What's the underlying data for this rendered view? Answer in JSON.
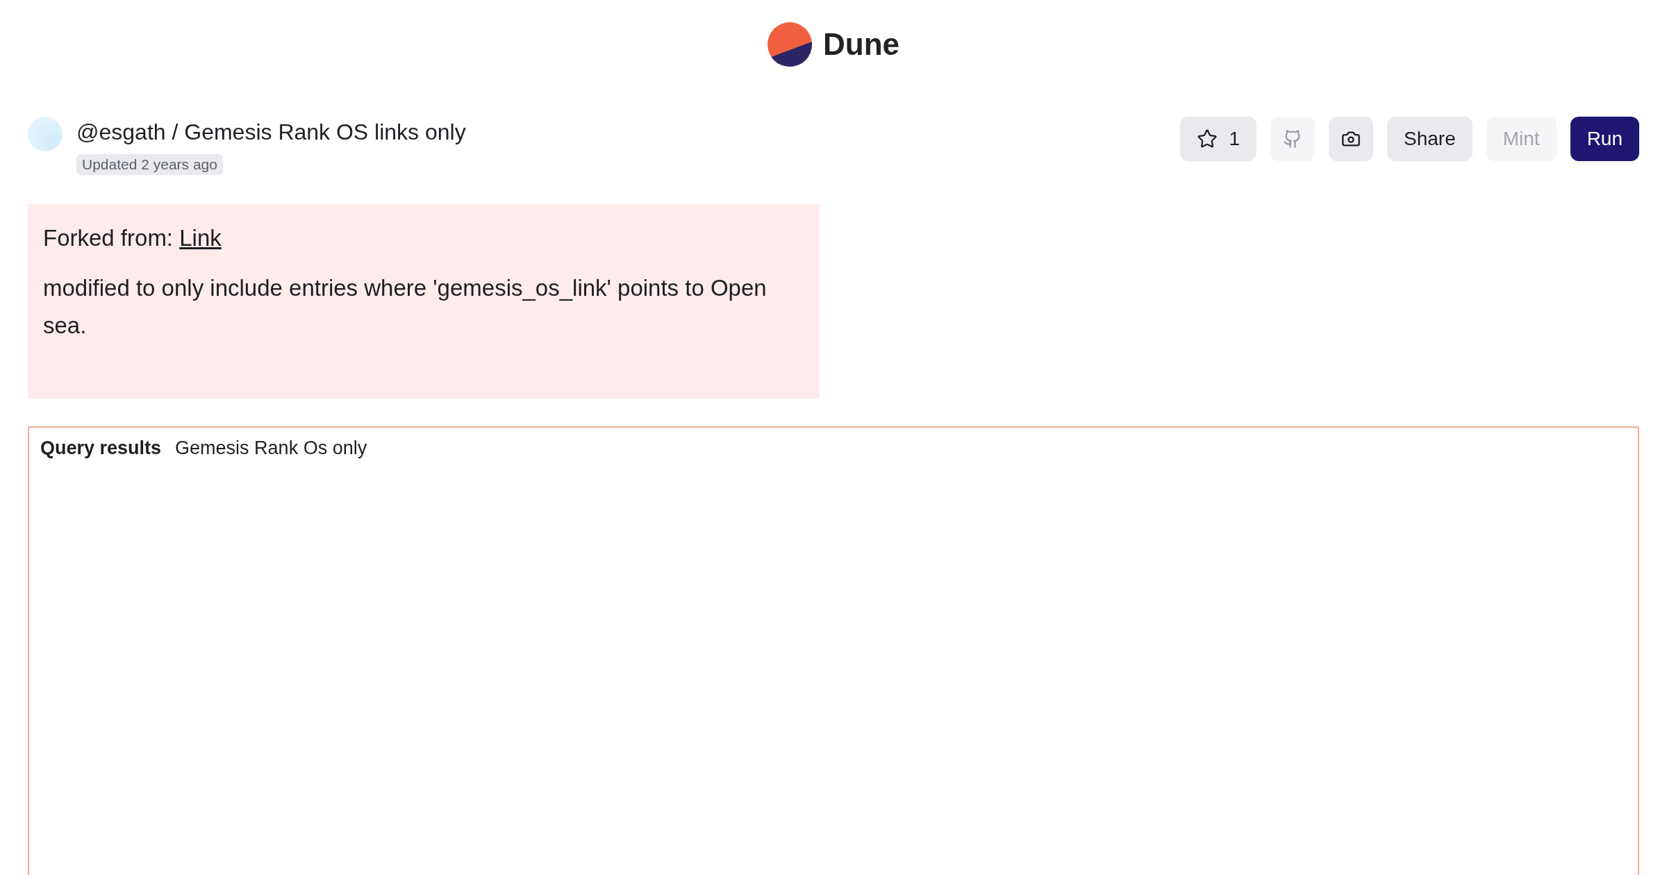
{
  "brand": {
    "name": "Dune"
  },
  "query": {
    "title": "@esgath / Gemesis Rank OS links only",
    "updated": "Updated 2 years ago"
  },
  "buttons": [
    {
      "kind": "star",
      "label": "1",
      "disabled": false
    },
    {
      "kind": "github",
      "disabled": true
    },
    {
      "kind": "camera",
      "disabled": false
    },
    {
      "kind": "text",
      "label": "Share",
      "disabled": false
    },
    {
      "kind": "text",
      "label": "Mint",
      "disabled": true
    },
    {
      "kind": "primary",
      "label": "Run",
      "disabled": false
    }
  ],
  "note": {
    "forked_label": "Forked from:",
    "link": "Link",
    "text": "modified to only include entries where 'gemesis_os_link' points to Open sea."
  },
  "results": {
    "label": "Query results",
    "name": "Gemesis Rank Os only"
  }
}
